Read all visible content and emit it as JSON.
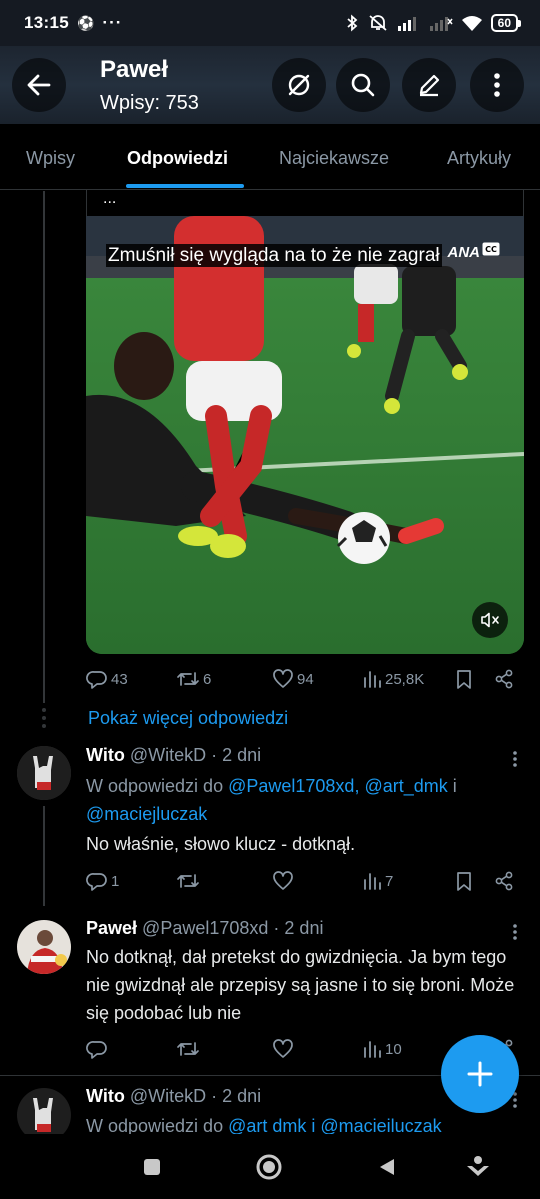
{
  "status_bar": {
    "time": "13:15",
    "battery": "60"
  },
  "header": {
    "title": "Paweł",
    "subtitle": "Wpisy: 753"
  },
  "tabs": [
    {
      "label": "Wpisy"
    },
    {
      "label": "Odpowiedzi",
      "active": true
    },
    {
      "label": "Najciekawsze"
    },
    {
      "label": "Artykuły"
    }
  ],
  "main_tweet": {
    "quote_ellipsis": "...",
    "media": {
      "caption": "Zmuśnił się wygląda na to że nie zagrał",
      "watermark": "ANA",
      "cc_badge": "CC"
    },
    "replies": "43",
    "reposts": "6",
    "likes": "94",
    "views": "25,8K"
  },
  "show_more_label": "Pokaż więcej odpowiedzi",
  "tweets": [
    {
      "name": "Wito",
      "handle": "@WitekD",
      "time": "· 2 dni",
      "reply_prefix": "W odpowiedzi do",
      "reply_to_1": "@Pawel1708xd, @art_dmk",
      "reply_joiner": "i",
      "reply_to_2": "@maciejluczak",
      "text": "No właśnie, słowo klucz - dotknął.",
      "replies": "1",
      "reposts": "",
      "likes": "",
      "views": "7"
    },
    {
      "name": "Paweł",
      "handle": "@Pawel1708xd",
      "time": "· 2 dni",
      "text": "No dotknął, dał pretekst do gwizdnięcia. Ja bym tego nie gwizdnął ale przepisy są jasne i to się broni. Może się podobać lub nie",
      "replies": "",
      "reposts": "",
      "likes": "",
      "views": "10"
    },
    {
      "name": "Wito",
      "handle": "@WitekD",
      "time": "· 2 dni",
      "reply_prefix": "W odpowiedzi do",
      "reply_to": "@art dmk i @macieiluczak"
    }
  ],
  "colors": {
    "accent": "#1d9bf0",
    "background": "#000000",
    "muted": "#8b98a5",
    "header_bg": "#1d2530"
  }
}
